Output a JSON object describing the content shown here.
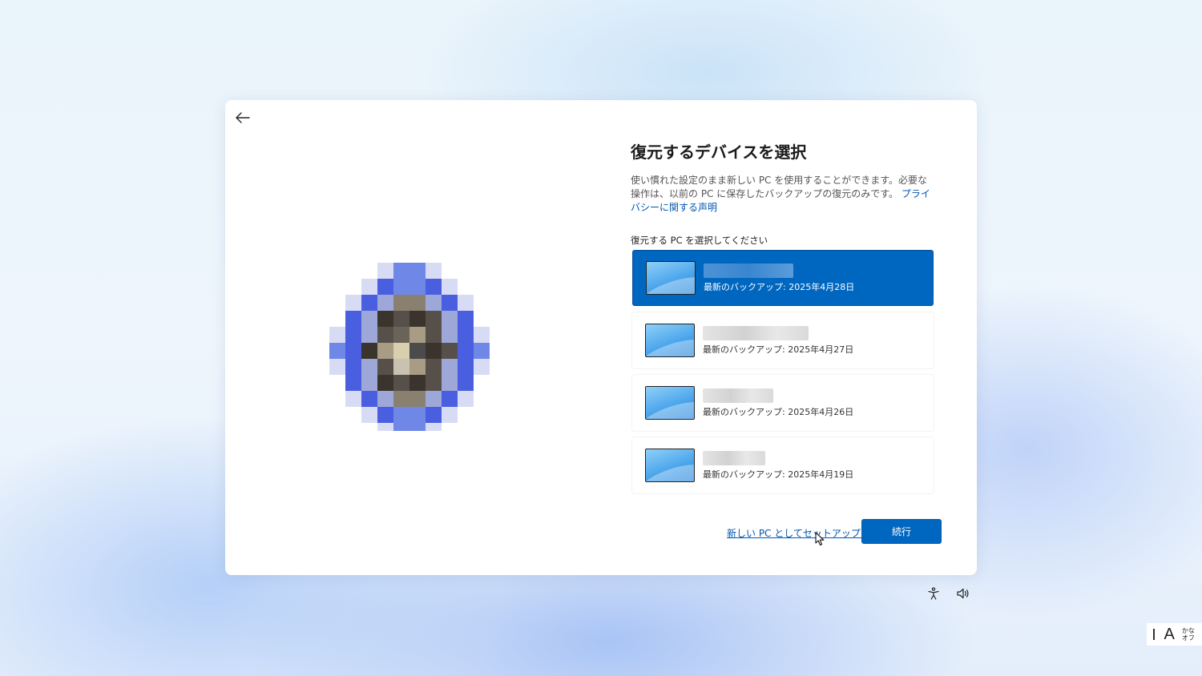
{
  "dialog": {
    "title": "復元するデバイスを選択",
    "description": "使い慣れた設定のまま新しい PC を使用することができます。必要な操作は、以前の PC に保存したバックアップの復元のみです。",
    "privacy_link": "プライバシーに関する声明",
    "subheading": "復元する PC を選択してください"
  },
  "devices": [
    {
      "backup": "最新のバックアップ: 2025年4月28日",
      "selected": true
    },
    {
      "backup": "最新のバックアップ: 2025年4月27日",
      "selected": false
    },
    {
      "backup": "最新のバックアップ: 2025年4月26日",
      "selected": false
    },
    {
      "backup": "最新のバックアップ: 2025年4月19日",
      "selected": false
    }
  ],
  "actions": {
    "setup_new": "新しい PC としてセットアップする",
    "continue": "続行"
  },
  "ime": {
    "letter": "A",
    "mode_line1": "かな",
    "mode_line2": "オフ"
  },
  "colors": {
    "accent": "#0067c0",
    "link": "#0056b3"
  },
  "icons": [
    "back-arrow-icon",
    "accessibility-icon",
    "volume-icon",
    "monitor-icon",
    "mouse-cursor-icon"
  ]
}
